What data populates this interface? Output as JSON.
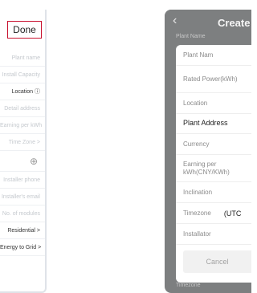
{
  "left_panel": {
    "done_label": "Done",
    "rows": [
      "Plant name",
      "Install Capacity",
      "Location ⓘ",
      "Detail address",
      "Earning per kWh",
      "Time Zone >",
      "⊕",
      "Installer phone",
      "Installer's email",
      "No. of modules",
      "Residential >",
      "Energy to Grid >"
    ]
  },
  "right_panel": {
    "back_icon": "‹",
    "title": "Create",
    "header_under": "Plant Name",
    "dialog": {
      "rows": [
        {
          "label": "Plant Nam"
        },
        {
          "label": "Rated Power(kWh)"
        },
        {
          "label": "Location"
        },
        {
          "label": "Plant Address"
        },
        {
          "label": "Currency"
        },
        {
          "label": "Earning per kWh(CNY/KWh)"
        },
        {
          "label": "Inclination"
        },
        {
          "label": "Timezone",
          "value": "(UTC"
        },
        {
          "label": "Installator"
        }
      ],
      "location_hint": "",
      "cancel_label": "Cancel"
    },
    "bottom_label": "Timezone"
  }
}
